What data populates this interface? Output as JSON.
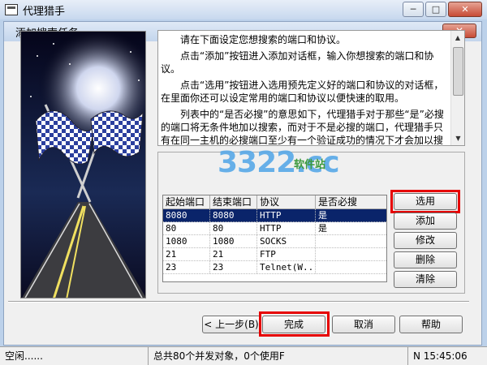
{
  "window": {
    "title": "代理猎手",
    "minimize": "─",
    "maximize": "□",
    "close": "✕"
  },
  "dialog": {
    "title": "添加搜索任务",
    "close": "✕"
  },
  "info": {
    "paragraphs": [
      "请在下面设定您想搜索的端口和协议。",
      "点击“添加”按钮进入添加对话框，输入你想搜索的端口和协议。",
      "点击“选用”按钮进入选用预先定义好的端口和协议的对话框，在里面你还可以设定常用的端口和协议以便快速的取用。",
      "列表中的“是否必搜”的意思如下，代理猎手对于那些“是”必搜的端口将无条件地加以搜索，而对于不是必搜的端口，代理猎手只有在同一主机的必搜端口至少有一个验证成功的情况下才会加以搜索，此选项对于那些有特殊代理服务很有用，一般的"
    ]
  },
  "table": {
    "headers": [
      "起始端口",
      "结束端口",
      "协议",
      "是否必搜"
    ],
    "rows": [
      [
        "8080",
        "8080",
        "HTTP",
        "是"
      ],
      [
        "80",
        "80",
        "HTTP",
        "是"
      ],
      [
        "1080",
        "1080",
        "SOCKS",
        ""
      ],
      [
        "21",
        "21",
        "FTP",
        ""
      ],
      [
        "23",
        "23",
        "Telnet(W...",
        ""
      ]
    ]
  },
  "side_buttons": {
    "select": "选用",
    "add": "添加",
    "edit": "修改",
    "delete": "删除",
    "clear": "清除"
  },
  "footer_buttons": {
    "back": "< 上一步(B)",
    "finish": "完成",
    "cancel": "取消",
    "help": "帮助"
  },
  "status": {
    "left": "空闲......",
    "middle": "总共80个并发对象，0个使用F",
    "right": "N 15:45:06"
  },
  "watermark": {
    "brand": "3322.cc",
    "sub": "软件站"
  },
  "colors": {
    "highlight": "#e60000",
    "selection": "#0a246a"
  }
}
